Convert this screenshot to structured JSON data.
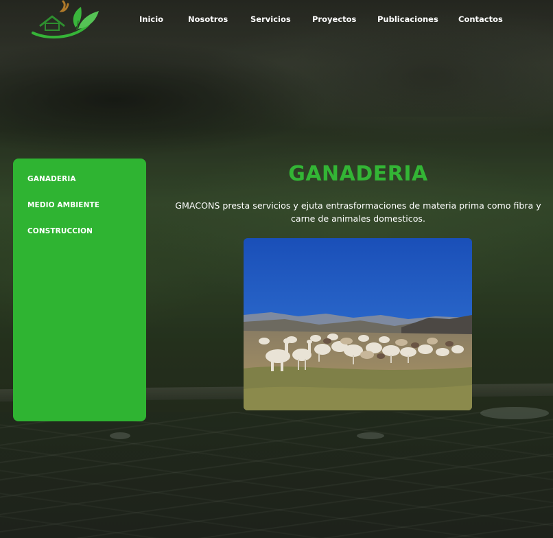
{
  "nav": {
    "items": [
      {
        "label": "Inicio"
      },
      {
        "label": "Nosotros"
      },
      {
        "label": "Servicios"
      },
      {
        "label": "Proyectos"
      },
      {
        "label": "Publicaciones"
      },
      {
        "label": "Contactos"
      }
    ]
  },
  "sidebar": {
    "items": [
      {
        "label": "GANADERIA"
      },
      {
        "label": "MEDIO AMBIENTE"
      },
      {
        "label": "CONSTRUCCION"
      }
    ]
  },
  "main": {
    "title": "GANADERIA",
    "description": "GMACONS presta servicios y ejuta entrasformaciones de materia prima como fibra y carne de animales domesticos."
  },
  "colors": {
    "accent_green": "#2fb432",
    "title_green": "#33b535"
  },
  "icons": {
    "logo": "house-leaf-logo"
  }
}
